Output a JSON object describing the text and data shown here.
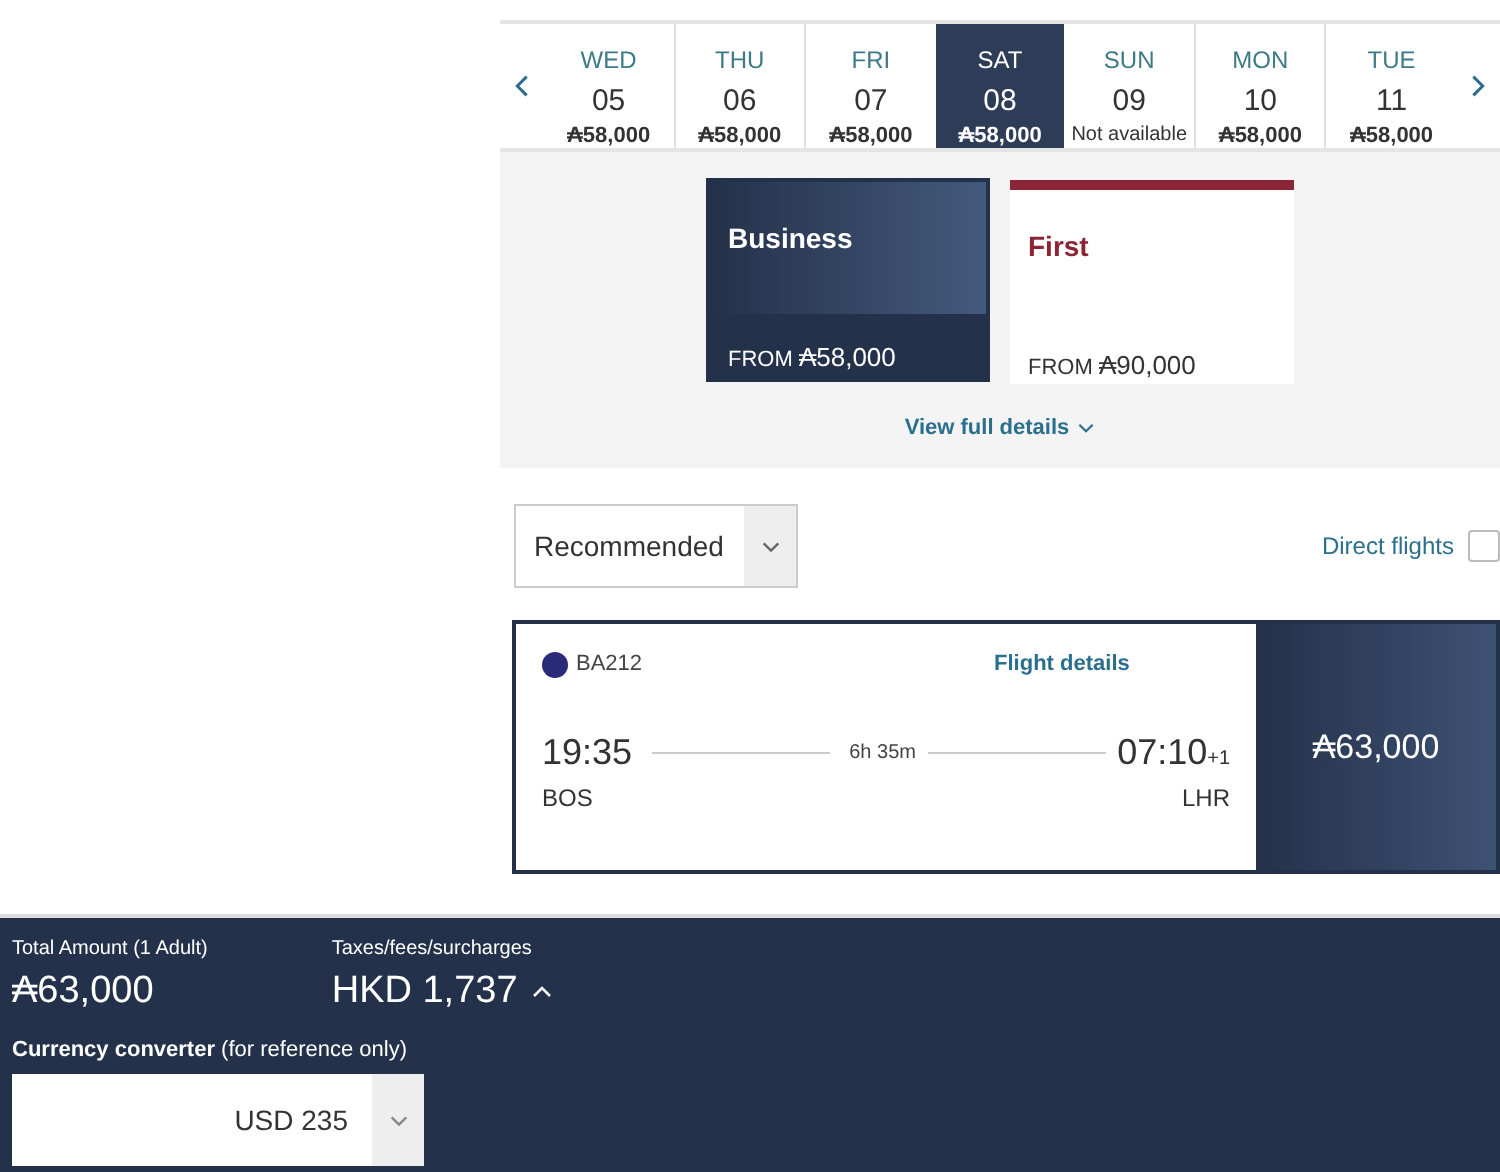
{
  "dates": [
    {
      "day": "WED",
      "date": "05",
      "price": "₳58,000",
      "selected": false
    },
    {
      "day": "THU",
      "date": "06",
      "price": "₳58,000",
      "selected": false
    },
    {
      "day": "FRI",
      "date": "07",
      "price": "₳58,000",
      "selected": false
    },
    {
      "day": "SAT",
      "date": "08",
      "price": "₳58,000",
      "selected": true
    },
    {
      "day": "SUN",
      "date": "09",
      "price": "Not available",
      "selected": false
    },
    {
      "day": "MON",
      "date": "10",
      "price": "₳58,000",
      "selected": false
    },
    {
      "day": "TUE",
      "date": "11",
      "price": "₳58,000",
      "selected": false
    }
  ],
  "cabins": [
    {
      "name": "Business",
      "from": "FROM",
      "price": "₳58,000",
      "selected": true
    },
    {
      "name": "First",
      "from": "FROM",
      "price": "₳90,000",
      "selected": false
    }
  ],
  "view_details": "View full details",
  "sort": {
    "value": "Recommended"
  },
  "direct_flights": {
    "label": "Direct flights",
    "checked": false
  },
  "flight": {
    "number": "BA212",
    "details_link": "Flight details",
    "depart_time": "19:35",
    "depart_airport": "BOS",
    "duration": "6h 35m",
    "arrive_time": "07:10",
    "day_offset": "+1",
    "arrive_airport": "LHR",
    "price": "₳63,000"
  },
  "summary": {
    "total_label": "Total Amount (1 Adult)",
    "total": "₳63,000",
    "taxes_label": "Taxes/fees/surcharges",
    "taxes": "HKD 1,737",
    "converter_label": "**Currency converter** (for reference only)",
    "converted": "USD 235"
  }
}
